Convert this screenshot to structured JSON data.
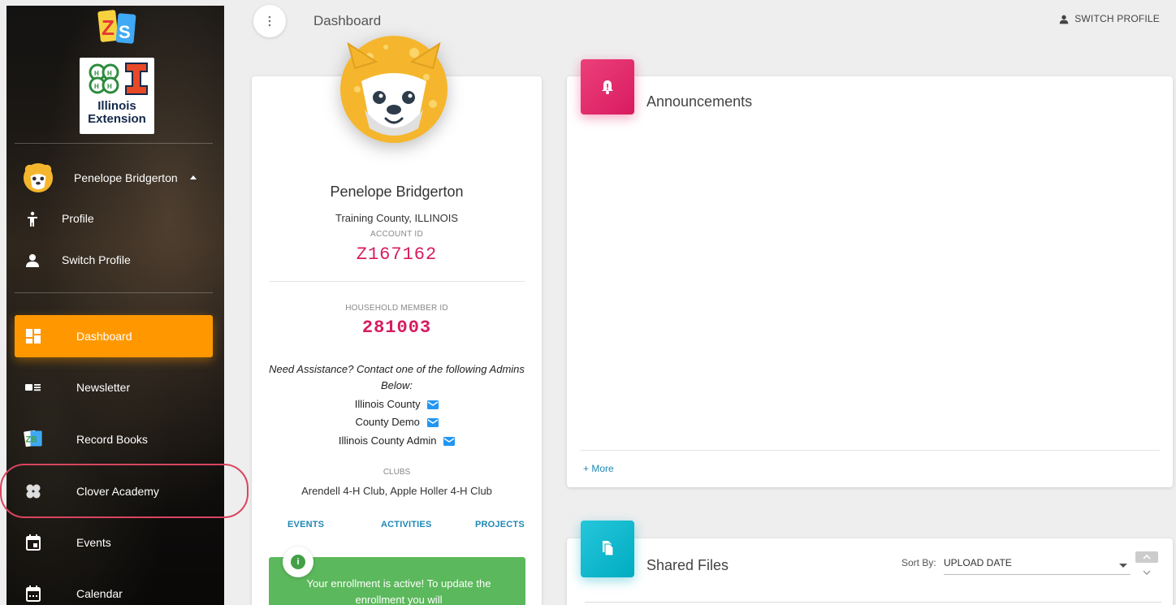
{
  "header": {
    "page_title": "Dashboard",
    "switch_profile_label": "SWITCH PROFILE"
  },
  "sidebar": {
    "extension_logo_text": "Illinois Extension",
    "user_name": "Penelope Bridgerton",
    "user_links": [
      {
        "label": "Profile",
        "icon": "person-walking-icon"
      },
      {
        "label": "Switch Profile",
        "icon": "person-icon"
      }
    ],
    "nav_items": [
      {
        "label": "Dashboard",
        "icon": "dashboard-icon",
        "active": true
      },
      {
        "label": "Newsletter",
        "icon": "newsletter-icon"
      },
      {
        "label": "Record Books",
        "icon": "record-books-icon"
      },
      {
        "label": "Clover Academy",
        "icon": "clover-icon"
      },
      {
        "label": "Events",
        "icon": "event-icon"
      },
      {
        "label": "Calendar",
        "icon": "calendar-icon"
      }
    ],
    "accent_color": "#ff9800"
  },
  "profile": {
    "name": "Penelope Bridgerton",
    "county": "Training County, ILLINOIS",
    "account_id_label": "ACCOUNT ID",
    "account_id": "Z167162",
    "household_member_id_label": "HOUSEHOLD MEMBER ID",
    "household_member_id": "281003",
    "assistance_text": "Need Assistance? Contact one of the following Admins Below:",
    "admins": [
      "Illinois County",
      "County Demo",
      "Illinois County Admin"
    ],
    "clubs_label": "CLUBS",
    "clubs": "Arendell 4-H Club, Apple Holler 4-H Club",
    "tabs": [
      "EVENTS",
      "ACTIVITIES",
      "PROJECTS"
    ],
    "enrollment_message": "Your enrollment is active! To update the enrollment you will",
    "id_color": "#d81b60"
  },
  "announcements": {
    "title": "Announcements",
    "more_label": "+ More",
    "badge_color": "#e91e63"
  },
  "shared_files": {
    "title": "Shared Files",
    "sort_by_label": "Sort By:",
    "sort_value": "UPLOAD DATE",
    "badge_color": "#00acc1"
  }
}
